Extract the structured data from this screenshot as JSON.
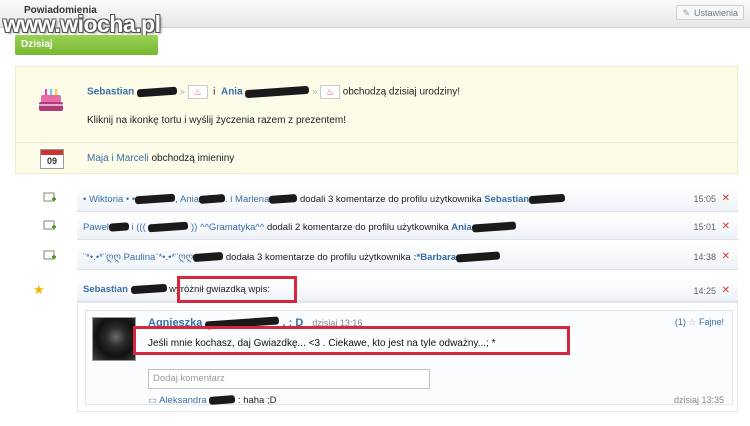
{
  "watermark": "www.wiocha.pl",
  "header": {
    "title": "Powiadomienia",
    "settings_label": "Ustawienia"
  },
  "day_label": "Dzisiaj",
  "birthday": {
    "name1": "Sebastian",
    "and_word": "i",
    "name2": "Ania",
    "text": "obchodzą dzisiaj urodziny!",
    "hint": "Kliknij na ikonkę tortu i wyślij życzenia razem z prezentem!"
  },
  "nameday": {
    "names": "Maja i Marceli",
    "text": "obchodzą imieniny",
    "calendar_day": "09"
  },
  "activity": [
    {
      "segments": [
        {
          "t": "• Wiktoria • •",
          "c": "lnk"
        },
        {
          "blur": 40
        },
        {
          "t": ", Ania",
          "c": "lnk"
        },
        {
          "blur": 26
        },
        {
          "t": ". i Marlena",
          "c": "lnk"
        },
        {
          "blur": 28
        },
        {
          "t": " dodali 3 komentarze do profilu użytkownika "
        },
        {
          "t": "Sebastian",
          "c": "lnk b"
        },
        {
          "blur": 36
        }
      ],
      "time": "15:05"
    },
    {
      "segments": [
        {
          "t": "Paweł",
          "c": "lnk"
        },
        {
          "blur": 20
        },
        {
          "t": " i ((( ",
          "c": "lnk"
        },
        {
          "blur": 40
        },
        {
          "t": " )) ^^Gramatyka^^",
          "c": "lnk"
        },
        {
          "t": " dodali 2 komentarze do profilu użytkownika "
        },
        {
          "t": "Ania",
          "c": "lnk b"
        },
        {
          "blur": 44
        }
      ],
      "time": "15:01"
    },
    {
      "segments": [
        {
          "t": "¨*•.•*¨ღღ Paulina¨*•.•*¨ღღ",
          "c": "lnk"
        },
        {
          "blur": 30
        },
        {
          "t": " dodała 3 komentarze do profilu użytkownika "
        },
        {
          "t": ":*Barbara",
          "c": "lnk b"
        },
        {
          "blur": 44
        }
      ],
      "time": "14:38"
    }
  ],
  "star_row": {
    "name": "Sebastian",
    "text": "wyróżnił gwiazdką wpis:",
    "time": "14:25"
  },
  "post": {
    "author": "Agnieszka",
    "author_suffix": ". ; D",
    "date": "dzisiaj 13:16",
    "likes_count": "(1)",
    "likes_label": "Fajne!",
    "text": "Jeśli mnie kochasz, daj Gwiazdkę... <3 . Ciekawe, kto jest na tyle odważny...; *",
    "comment_placeholder": "Dodaj komentarz",
    "reply_author": "Aleksandra",
    "reply_text": ": haha ;D",
    "reply_date": "dzisiaj 13:35"
  },
  "close_symbol": "✕"
}
